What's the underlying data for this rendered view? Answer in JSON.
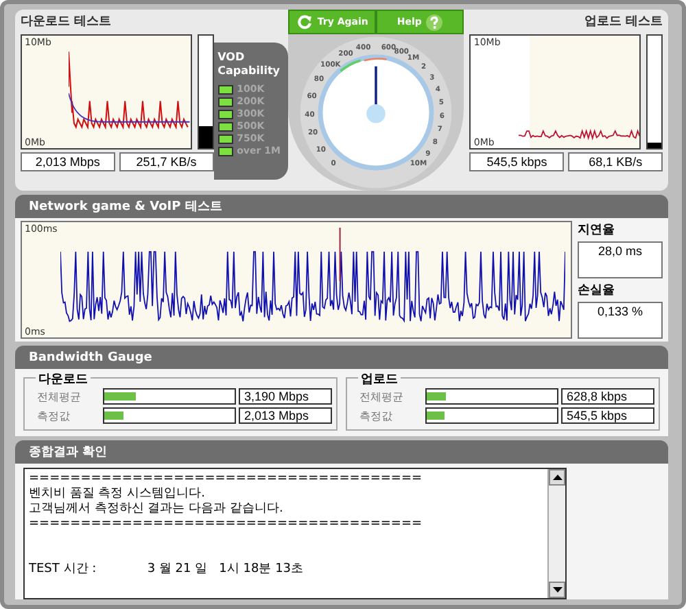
{
  "download": {
    "title": "다운로드 테스트",
    "y_top": "10Mb",
    "y_bottom": "0Mb",
    "meter": {
      "level": 0.2
    },
    "speed": "2,013 Mbps",
    "rate": "251,7 KB/s"
  },
  "vod": {
    "title": "VOD Capability",
    "items": [
      {
        "label": "100K",
        "on": true
      },
      {
        "label": "200K",
        "on": true
      },
      {
        "label": "300K",
        "on": true
      },
      {
        "label": "500K",
        "on": true
      },
      {
        "label": "750K",
        "on": true
      },
      {
        "label": "over 1M",
        "on": true
      }
    ]
  },
  "buttons": [
    {
      "label": "Try Again",
      "kind": "retry"
    },
    {
      "label": "Help",
      "kind": "help"
    }
  ],
  "dial": {
    "left_labels": [
      "400",
      "200",
      "100K",
      "80",
      "60",
      "40",
      "20",
      "10",
      "0"
    ],
    "right_labels": [
      "600",
      "800",
      "1M",
      "2",
      "3",
      "4",
      "5",
      "6",
      "7",
      "8",
      "9",
      "10M"
    ]
  },
  "upload": {
    "title": "업로드 테스트",
    "y_top": "10Mb",
    "y_bottom": "0Mb",
    "meter": {
      "level": 0.05
    },
    "speed": "545,5 kbps",
    "rate": "68,1 KB/s"
  },
  "network": {
    "title": "Network game & VoIP 테스트",
    "y_top": "100ms",
    "y_bottom": "0ms",
    "delay_label": "지연율",
    "delay": "28,0 ms",
    "loss_label": "손실율",
    "loss": "0,133 %"
  },
  "bandwidth": {
    "title": "Bandwidth Gauge",
    "groups": [
      {
        "title": "다운로드",
        "rows": [
          {
            "label": "전체평균",
            "level": 0.24,
            "value": "3,190 Mbps"
          },
          {
            "label": "측정값",
            "level": 0.15,
            "value": "2,013 Mbps"
          }
        ]
      },
      {
        "title": "업로드",
        "rows": [
          {
            "label": "전체평균",
            "level": 0.15,
            "value": "628,8 kbps"
          },
          {
            "label": "측정값",
            "level": 0.14,
            "value": "545,5 kbps"
          }
        ]
      }
    ]
  },
  "results": {
    "title": "종합결과 확인",
    "lines": [
      "======================================",
      "벤치비 품질 측정 시스템입니다.",
      "고객님께서 측정하신 결과는 다음과 같습니다.",
      "======================================",
      "TEST 시간 :             3 월 21 일   1시 18분 13초"
    ]
  }
}
